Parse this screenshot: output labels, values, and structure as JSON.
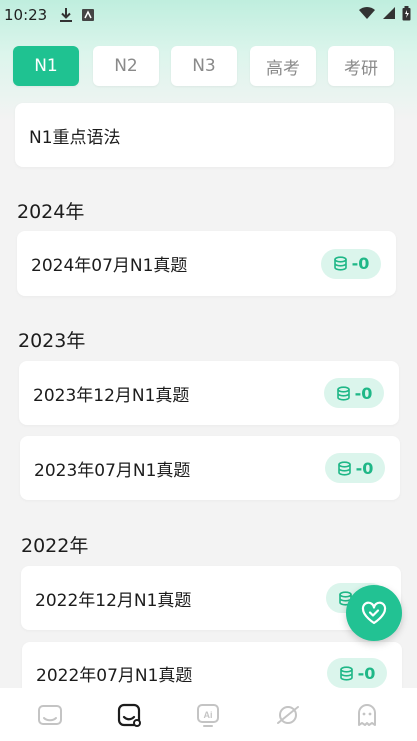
{
  "status_bar": {
    "time": "10:23",
    "icons": [
      "download-icon",
      "app-notification-icon",
      "wifi-icon",
      "signal-icon",
      "battery-icon"
    ]
  },
  "tabs": [
    {
      "label": "N1",
      "active": true
    },
    {
      "label": "N2",
      "active": false
    },
    {
      "label": "N3",
      "active": false
    },
    {
      "label": "高考",
      "active": false
    },
    {
      "label": "考研",
      "active": false
    }
  ],
  "grammar_card": {
    "label": "N1重点语法"
  },
  "sections": [
    {
      "year": "2024年",
      "items": [
        {
          "title": "2024年07月N1真题",
          "badge": "-0"
        }
      ]
    },
    {
      "year": "2023年",
      "items": [
        {
          "title": "2023年12月N1真题",
          "badge": "-0"
        },
        {
          "title": "2023年07月N1真题",
          "badge": "-0"
        }
      ]
    },
    {
      "year": "2022年",
      "items": [
        {
          "title": "2022年12月N1真题",
          "badge": "-0"
        },
        {
          "title": "2022年07月N1真题",
          "badge": "-0"
        }
      ]
    }
  ],
  "bottom_nav": {
    "items": [
      "study-icon",
      "exam-icon",
      "ai-icon",
      "planet-icon",
      "profile-icon"
    ],
    "active_index": 1
  },
  "colors": {
    "accent": "#1fc291",
    "badge_bg": "#dbf5ec",
    "badge_text": "#1fb787"
  }
}
